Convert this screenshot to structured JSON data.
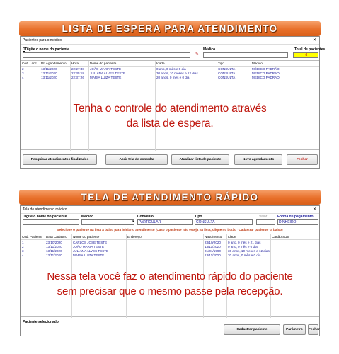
{
  "top": {
    "banner": "LISTA DE ESPERA PARA ATENDIMENTO",
    "window_title": "Pacientes para o médico",
    "close_glyph": "✕",
    "search_label": "Digite o nome do paciente",
    "medico_label": "Médico",
    "total_label": "Total de pacientes",
    "total_value": "4",
    "columns": [
      "Cod. Lanc",
      "Dt. Agendamento",
      "Hora",
      "Nome do paciente",
      "Idade",
      "Tipo",
      "Médico"
    ],
    "rows": [
      [
        "2",
        "13/11/2020",
        "22:27:38",
        "JOÃO MARIA TESTE",
        "0 ano, 0 mês e 0 dia",
        "CONSULTA",
        "MÉDICO PADRÃO"
      ],
      [
        "3",
        "13/11/2020",
        "22:35:18",
        "JULIANA ALVES TESTE",
        "30 anos, 10 meses e 12 dias",
        "CONSULTA",
        "MÉDICO PADRÃO"
      ],
      [
        "4",
        "13/11/2020",
        "22:37:26",
        "MARIA LUIZA TESTE",
        "20 anos, 0 mês e 0 dia",
        "CONSULTA",
        "MÉDICO PADRÃO"
      ]
    ],
    "overlay_line1": "Tenha o controle do atendimento através",
    "overlay_line2": "da lista de espera.",
    "buttons": {
      "finalizados": "Pesquisar atendimentos finalizados",
      "abrir": "Abrir tela de consulta",
      "atualizar": "Atualizar lista de paciente",
      "novo": "Novo agendamento",
      "fechar": "Fechar"
    }
  },
  "bottom": {
    "banner": "TELA DE ATENDIMENTO RÁPIDO",
    "window_title": "Tela de atendimento médico",
    "close_glyph": "✕",
    "search_label": "Digite o nome do paciente",
    "medico_label": "Médico",
    "convenio_label": "Convênio",
    "convenio_value": "PARTICULAR",
    "tipo_label": "Tipo",
    "tipo_value": "CONSULTA",
    "valor_label": "Valor",
    "pagamento_label": "Forma de pagamento",
    "pagamento_value": "DINHEIRO",
    "warning": "Selecione o paciente na lista a baixo para iniciar o atendimento (Caso o paciente não esteja na lista, clique no botão \"Cadastrar paciente\" a baixo)",
    "columns": [
      "Cod. Paciente",
      "Data Cadastro",
      "Nome do paciente",
      "Endereço",
      "Nascimento",
      "Idade",
      "Cartão SUS"
    ],
    "rows": [
      [
        "1",
        "23/10/2020",
        "CARLOS JOSE TESTE",
        "",
        "23/10/2020",
        "0 ano, 0 mês e 21 dias",
        ""
      ],
      [
        "2",
        "13/11/2020",
        "JOÃO MARIA TESTE",
        "",
        "13/11/2020",
        "0 ano, 0 mês e 0 dia",
        ""
      ],
      [
        "3",
        "13/11/2020",
        "JULIANA ALVES TESTE",
        "",
        "01/01/1990",
        "30 anos, 10 meses e 12 dias",
        ""
      ],
      [
        "4",
        "13/11/2020",
        "MARIA LUIZA TESTE",
        "",
        "13/11/2000",
        "20 anos, 0 mês e 0 dia",
        ""
      ]
    ],
    "overlay_line1": "Nessa tela você faz o atendimento rápido do paciente",
    "overlay_line2": "sem precisar que o mesmo passe pela recepção.",
    "selected_label": "Paciente selecionado",
    "buttons": {
      "cadastrar": "Cadastrar paciente",
      "parametro": "Parâmetro",
      "fechar": "Fechar"
    }
  },
  "colors": {
    "banner": "#e8702a",
    "overlay_text": "#c0180f",
    "total_bg": "#ffff00",
    "grid_text": "#1a1a9a"
  }
}
